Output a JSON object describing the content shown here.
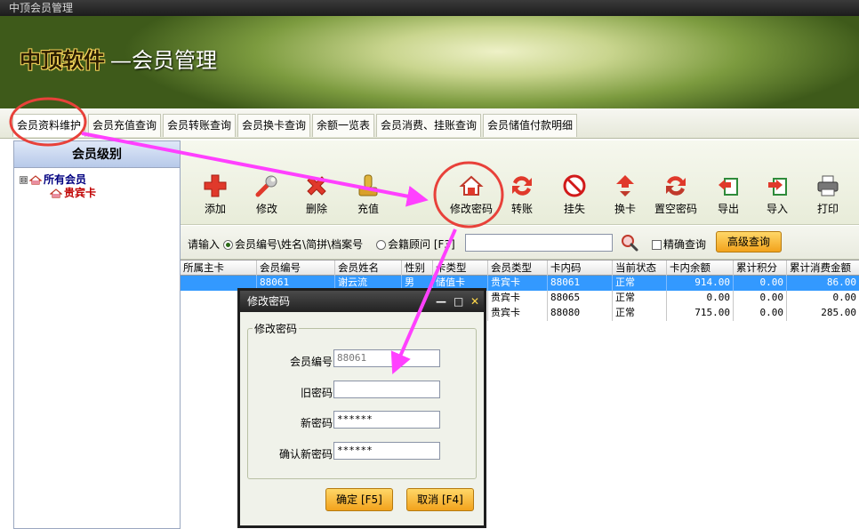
{
  "window": {
    "title": "中顶会员管理"
  },
  "banner": {
    "brand": "中顶软件",
    "subtitle": "—会员管理"
  },
  "tabs": [
    {
      "label": "会员资料维护"
    },
    {
      "label": "会员充值查询"
    },
    {
      "label": "会员转账查询"
    },
    {
      "label": "会员换卡查询"
    },
    {
      "label": "余额一览表"
    },
    {
      "label": "会员消费、挂账查询"
    },
    {
      "label": "会员储值付款明细"
    }
  ],
  "sidebar": {
    "title": "会员级别",
    "tree": [
      {
        "label": "所有会员",
        "toggle": "⊟"
      },
      {
        "label": "贵宾卡"
      }
    ]
  },
  "toolbar": {
    "buttons": [
      {
        "label": "添加",
        "icon": "plus-icon"
      },
      {
        "label": "修改",
        "icon": "wrench-icon"
      },
      {
        "label": "删除",
        "icon": "delete-x-icon"
      },
      {
        "label": "充值",
        "icon": "deposit-icon"
      },
      {
        "label": "修改密码",
        "icon": "house-key-icon"
      },
      {
        "label": "转账",
        "icon": "transfer-icon"
      },
      {
        "label": "挂失",
        "icon": "no-entry-icon"
      },
      {
        "label": "换卡",
        "icon": "swap-card-icon"
      },
      {
        "label": "置空密码",
        "icon": "reset-password-icon"
      },
      {
        "label": "导出",
        "icon": "export-icon"
      },
      {
        "label": "导入",
        "icon": "import-icon"
      },
      {
        "label": "打印",
        "icon": "printer-icon"
      }
    ]
  },
  "search": {
    "prompt": "请输入",
    "option1": "会员编号\\姓名\\简拼\\档案号",
    "option2": "会籍顾问 [F3]",
    "exact_label": "精确查询",
    "advanced_button": "高级查询",
    "value": ""
  },
  "grid": {
    "columns": [
      "所属主卡",
      "会员编号",
      "会员姓名",
      "性别",
      "卡类型",
      "会员类型",
      "卡内码",
      "当前状态",
      "卡内余额",
      "累计积分",
      "累计消费金额"
    ],
    "rows": [
      [
        "",
        "88061",
        "谢云流",
        "男",
        "储值卡",
        "贵宾卡",
        "88061",
        "正常",
        "914.00",
        "0.00",
        "86.00"
      ],
      [
        "",
        "",
        "",
        "",
        "",
        "贵宾卡",
        "88065",
        "正常",
        "0.00",
        "0.00",
        "0.00"
      ],
      [
        "",
        "",
        "",
        "",
        "",
        "贵宾卡",
        "88080",
        "正常",
        "715.00",
        "0.00",
        "285.00"
      ]
    ]
  },
  "dialog": {
    "title": "修改密码",
    "controls": {
      "minimize": "—",
      "maximize": "□",
      "close": "✕"
    },
    "group_title": "修改密码",
    "fields": {
      "member_id_label": "会员编号",
      "member_id_value": "88061",
      "old_password_label": "旧密码",
      "old_password_value": "",
      "new_password_label": "新密码",
      "new_password_value": "******",
      "confirm_password_label": "确认新密码",
      "confirm_password_value": "******"
    },
    "ok_button": "确定 [F5]",
    "cancel_button": "取消 [F4]"
  },
  "colors": {
    "annotation_circle": "#e8413a",
    "annotation_arrow": "#ff40ff",
    "selection": "#3399ff",
    "button_gold": "#f2a21c"
  }
}
